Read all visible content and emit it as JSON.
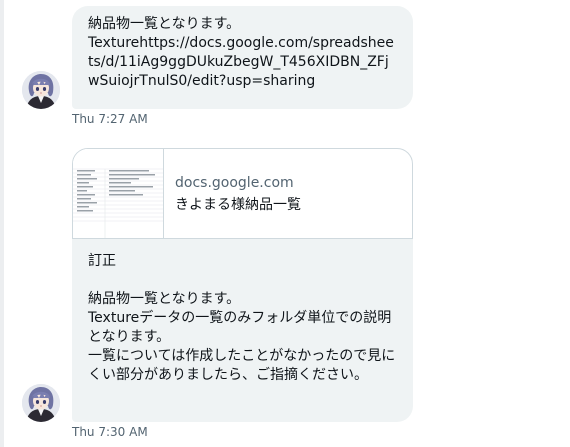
{
  "messages": [
    {
      "text": "納品物一覧となります。\nTexturehttps://docs.google.com/spreadsheets/d/11iAg9ggDUkuZbegW_T456XIDBN_ZFjwSuiojrTnulS0/edit?usp=sharing",
      "timestamp": "Thu 7:27 AM"
    },
    {
      "card": {
        "domain": "docs.google.com",
        "title": "きよまる様納品一覧"
      },
      "text": "訂正\n\n納品物一覧となります。\nTextureデータの一覧のみフォルダ単位での説明となります。\n一覧については作成したことがなかったので見にくい部分がありましたら、ご指摘ください。",
      "timestamp": "Thu 7:30 AM"
    }
  ],
  "colors": {
    "bubble_bg": "#eff3f4",
    "text": "#0f1419",
    "muted": "#536471",
    "border": "#cfd9de"
  },
  "icons": {
    "avatar": "anime-character-avatar",
    "thumbnail": "spreadsheet-thumbnail"
  }
}
